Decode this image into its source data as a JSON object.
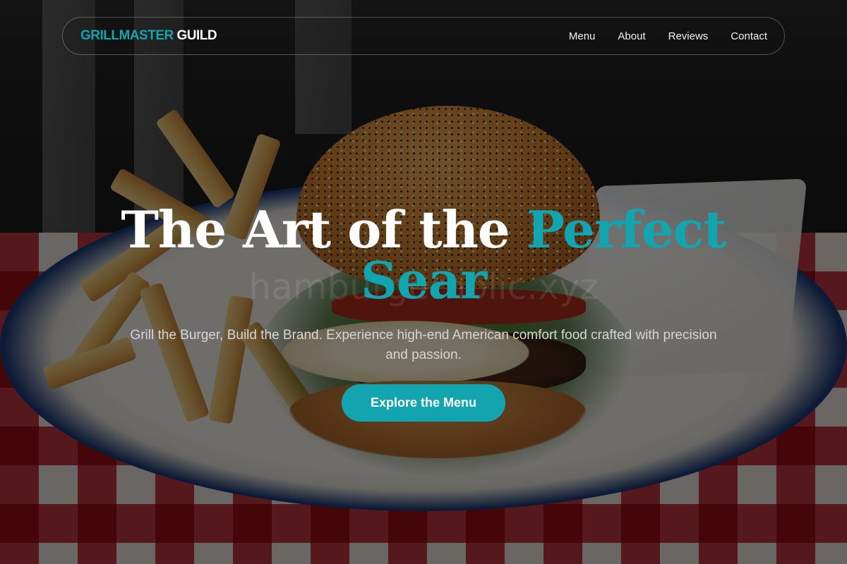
{
  "colors": {
    "accent": "#12a5b0",
    "text": "#ffffff",
    "subtext": "#d6d6d6",
    "overlay": "rgba(0,0,0,0.55)"
  },
  "background": {
    "image_subject": "gourmet burger with fries on blue-rimmed plate over red gingham tablecloth"
  },
  "navbar": {
    "brand_part1": "GRILLMASTER",
    "brand_part2": "GUILD",
    "links": [
      "Menu",
      "About",
      "Reviews",
      "Contact"
    ]
  },
  "hero": {
    "title_line": "The Art of the",
    "title_highlight": "Perfect",
    "title_line2": "Sear",
    "watermark": "hamburgerholic.xyz",
    "subtitle": "Grill the Burger, Build the Brand. Experience high-end American comfort food crafted with precision and passion.",
    "cta_label": "Explore the Menu"
  }
}
